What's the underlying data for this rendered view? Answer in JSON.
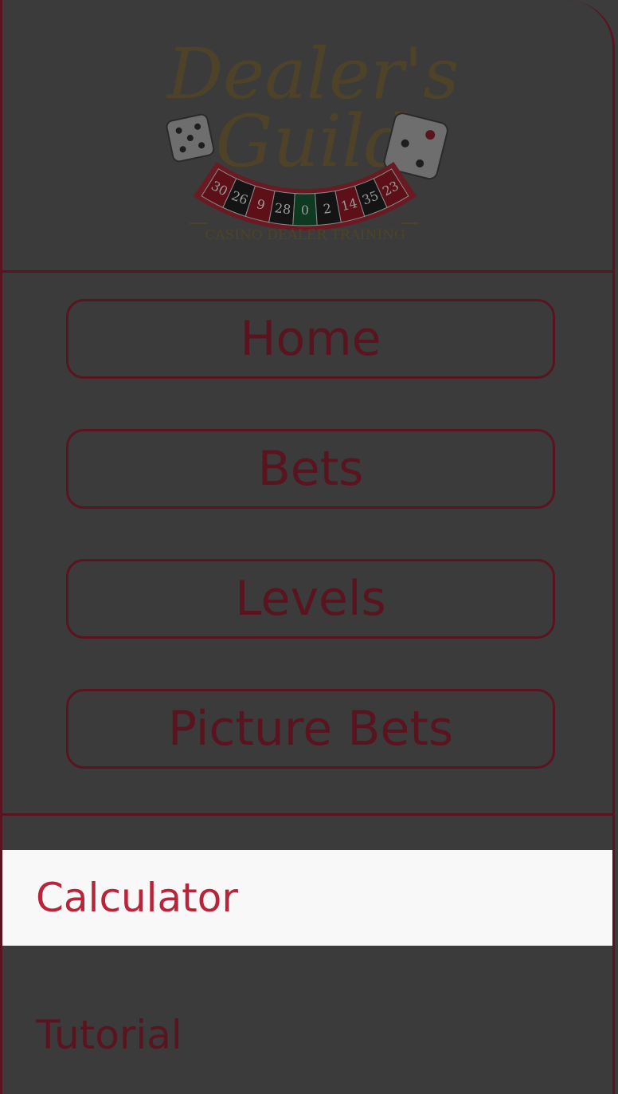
{
  "logo": {
    "title_line1": "Dealer's",
    "title_line2": "Guild",
    "subtitle": "CASINO DEALER TRAINING",
    "wheel_numbers": [
      "30",
      "26",
      "9",
      "28",
      "0",
      "2",
      "14",
      "35",
      "23"
    ]
  },
  "nav": {
    "buttons": [
      {
        "label": "Home"
      },
      {
        "label": "Bets"
      },
      {
        "label": "Levels"
      },
      {
        "label": "Picture Bets"
      }
    ]
  },
  "menu": {
    "items": [
      {
        "label": "Calculator",
        "active": true
      },
      {
        "label": "Tutorial",
        "active": false
      }
    ]
  },
  "colors": {
    "scrim_bg": "#3c3c3c",
    "border": "#5a1420",
    "accent": "#b8253a",
    "active_bg": "#f8f8f8"
  }
}
